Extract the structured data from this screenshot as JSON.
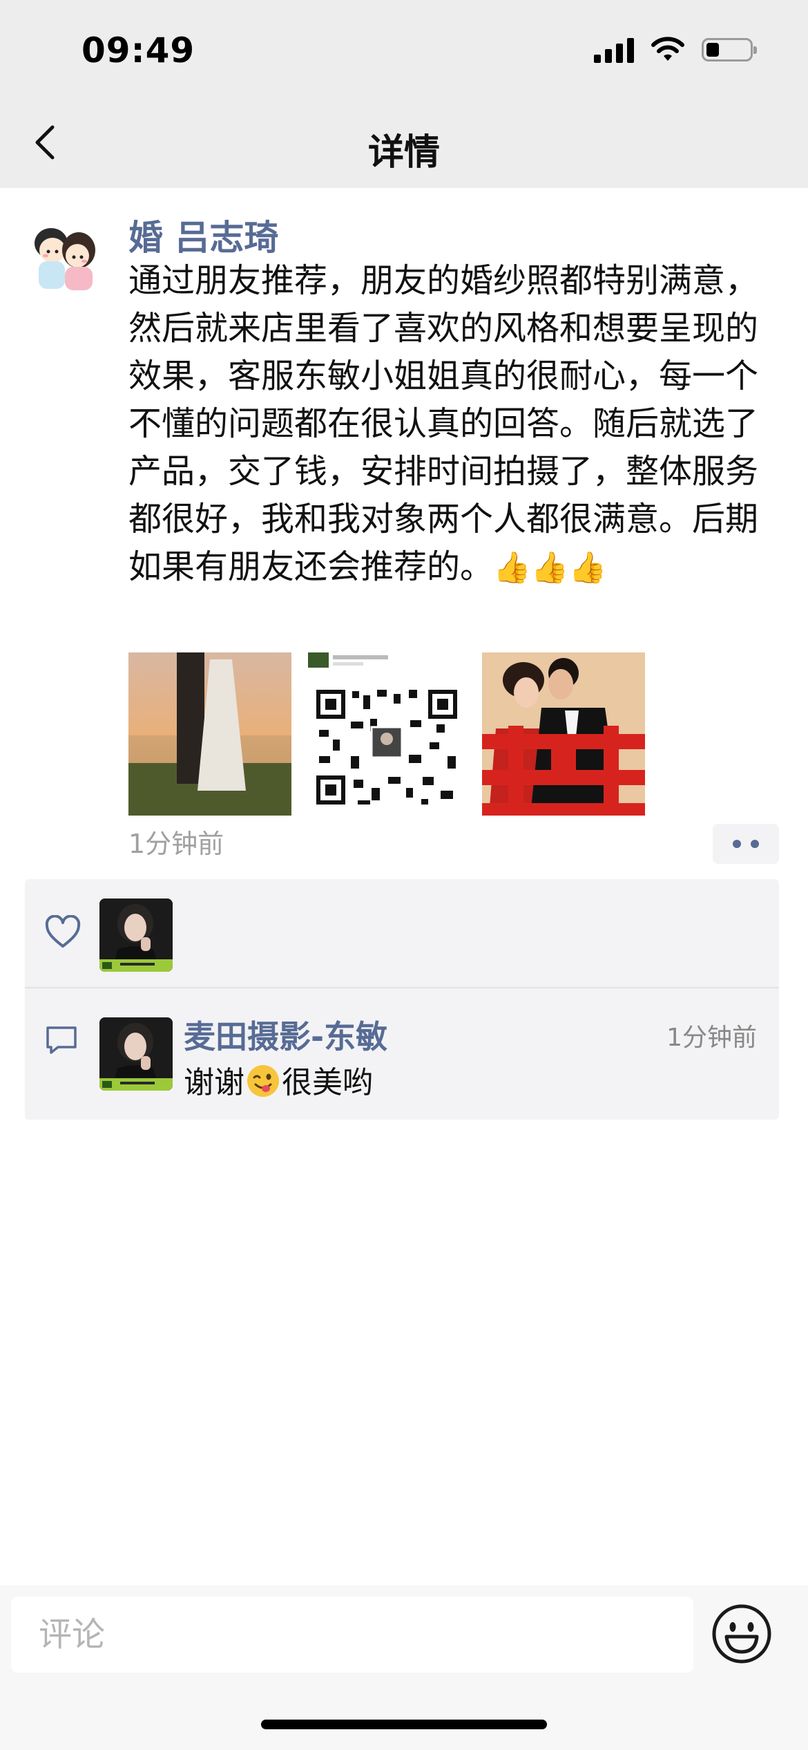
{
  "status_bar": {
    "time": "09:49"
  },
  "nav": {
    "title": "详情"
  },
  "post": {
    "author": "婚 吕志琦",
    "text": "通过朋友推荐，朋友的婚纱照都特别满意，然后就来店里看了喜欢的风格和想要呈现的效果，客服东敏小姐姐真的很耐心，每一个不懂的问题都在很认真的回答。随后就选了产品，交了钱，安排时间拍摄了，整体服务都很好，我和我对象两个人都很满意。后期如果有朋友还会推荐的。",
    "emojis": "👍👍👍",
    "images": [
      "sunset-couple-photo",
      "qr-code-image",
      "chinese-wedding-photo"
    ],
    "time": "1分钟前"
  },
  "comment": {
    "name": "麦田摄影-东敏",
    "time": "1分钟前",
    "text_before": "谢谢",
    "text_after": "很美哟"
  },
  "input": {
    "placeholder": "评论"
  },
  "colors": {
    "link_blue": "#576b95",
    "panel_bg": "#f3f3f5",
    "header_bg": "#ededed"
  }
}
